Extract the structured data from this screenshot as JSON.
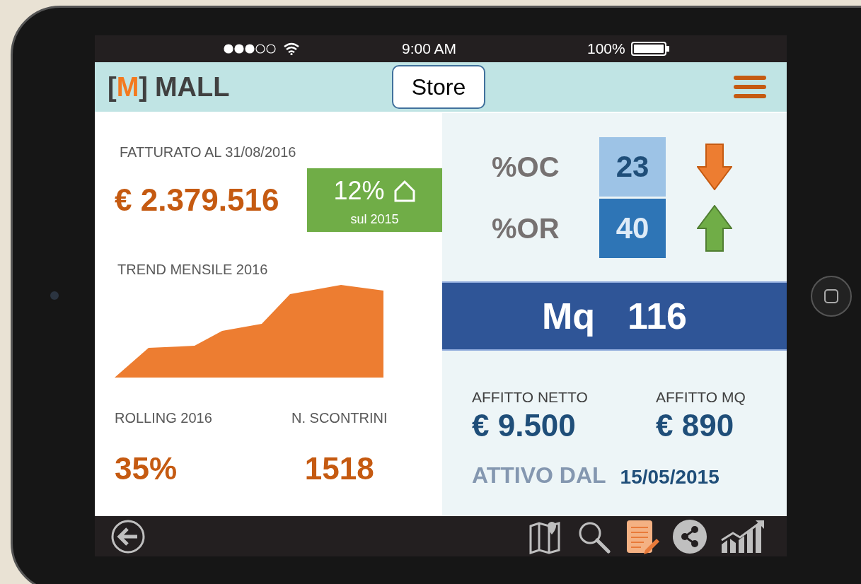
{
  "status_bar": {
    "time": "9:00 AM",
    "battery": "100%"
  },
  "header": {
    "logo_open": "[",
    "logo_letter": "M",
    "logo_close": "]",
    "logo_name": "MALL",
    "store_button": "Store"
  },
  "revenue": {
    "label": "FATTURATO AL 31/08/2016",
    "value": "€ 2.379.516",
    "change": "12%",
    "change_note": "sul 2015"
  },
  "trend": {
    "label": "TREND MENSILE 2016"
  },
  "stats": [
    {
      "label": "ROLLING 2016",
      "value": "35%"
    },
    {
      "label": "N. SCONTRINI",
      "value": "1518"
    }
  ],
  "indicators": [
    {
      "label": "%OC",
      "value": "23",
      "color": "#9dc3e6",
      "kind": "down"
    },
    {
      "label": "%OR",
      "value": "40",
      "color": "#2e75b6",
      "kind": "up"
    }
  ],
  "area": {
    "label": "Mq",
    "value": "116"
  },
  "rent": [
    {
      "label": "AFFITTO NETTO",
      "value": "€ 9.500"
    },
    {
      "label": "AFFITTO MQ",
      "value": "€ 890"
    }
  ],
  "active_since": {
    "label": "ATTIVO DAL",
    "value": "15/05/2015"
  },
  "toolbar": [
    {
      "kind": "map",
      "selected": false
    },
    {
      "kind": "search",
      "selected": false
    },
    {
      "kind": "notes",
      "selected": true
    },
    {
      "kind": "share",
      "selected": false
    },
    {
      "kind": "chart",
      "selected": false
    }
  ]
}
